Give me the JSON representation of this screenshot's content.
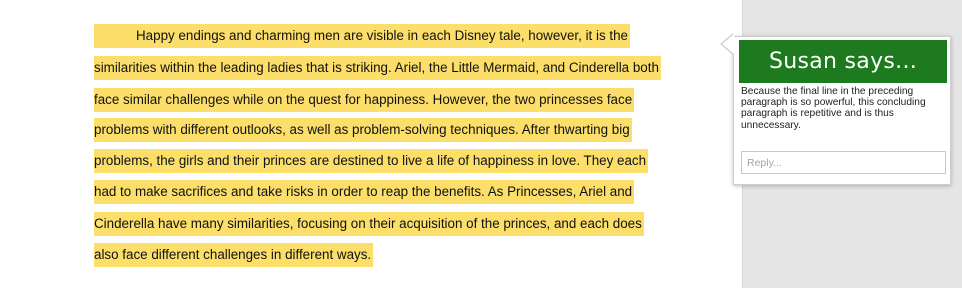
{
  "document": {
    "lines": [
      "Happy endings and charming men are visible in each Disney tale, however, it is the",
      "similarities within the leading ladies that is striking. Ariel, the Little Mermaid, and Cinderella both",
      "face similar challenges while on the quest for happiness. However, the two princesses face",
      "problems with different outlooks, as well as problem-solving techniques. After thwarting big",
      "problems, the girls and their princes are destined to live a life of happiness in love. They each",
      "had to make sacrifices and take risks in order to reap the benefits. As Princesses, Ariel and",
      "Cinderella have many similarities, focusing on their acquisition of the princes, and each does",
      "also face different challenges in different ways."
    ],
    "highlight_color": "#fcde6a"
  },
  "comment": {
    "author_header": "Susan says...",
    "header_color": "#1e7a1e",
    "body": "Because the final line in the preceding paragraph is so powerful, this concluding paragraph is repetitive and is thus unnecessary.",
    "reply_placeholder": "Reply..."
  }
}
